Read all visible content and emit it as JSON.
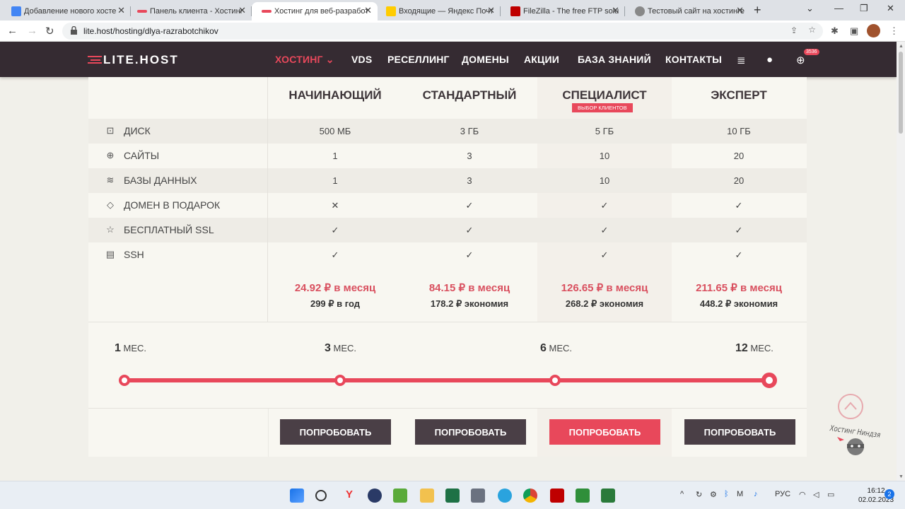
{
  "browser": {
    "tabs": [
      {
        "title": "Добавление нового хосте",
        "color": "#4285f4"
      },
      {
        "title": "Панель клиента - Хостинг",
        "color": "#e8485b"
      },
      {
        "title": "Хостинг для веб-разработ",
        "color": "#e8485b"
      },
      {
        "title": "Входящие — Яндекс Почт",
        "color": "#ffcc00"
      },
      {
        "title": "FileZilla - The free FTP solu",
        "color": "#bf0000"
      },
      {
        "title": "Тестовый сайт на хостинге",
        "color": "#666666"
      }
    ],
    "url": "lite.host/hosting/dlya-razrabotchikov"
  },
  "site": {
    "logo": "LITE.HOST",
    "menu": [
      "ХОСТИНГ",
      "VDS",
      "РЕСЕЛЛИНГ",
      "ДОМЕНЫ",
      "АКЦИИ",
      "БАЗА ЗНАНИЙ",
      "КОНТАКТЫ"
    ],
    "cart_badge": "3536"
  },
  "plans": [
    {
      "name": "НАЧИНАЮЩИЙ",
      "price": "24.92 ₽ в месяц",
      "save": "299 ₽ в год",
      "button": "ПОПРОБОВАТЬ"
    },
    {
      "name": "СТАНДАРТНЫЙ",
      "price": "84.15 ₽ в месяц",
      "save": "178.2 ₽ экономия",
      "button": "ПОПРОБОВАТЬ"
    },
    {
      "name": "СПЕЦИАЛИСТ",
      "badge": "ВЫБОР КЛИЕНТОВ",
      "price": "126.65 ₽ в месяц",
      "save": "268.2 ₽ экономия",
      "button": "ПОПРОБОВАТЬ"
    },
    {
      "name": "ЭКСПЕРТ",
      "price": "211.65 ₽ в месяц",
      "save": "448.2 ₽ экономия",
      "button": "ПОПРОБОВАТЬ"
    }
  ],
  "features": [
    {
      "label": "ДИСК",
      "icon": "disk-icon",
      "values": [
        "500 МБ",
        "3 ГБ",
        "5 ГБ",
        "10 ГБ"
      ]
    },
    {
      "label": "САЙТЫ",
      "icon": "globe-icon",
      "values": [
        "1",
        "3",
        "10",
        "20"
      ]
    },
    {
      "label": "БАЗЫ ДАННЫХ",
      "icon": "database-icon",
      "values": [
        "1",
        "3",
        "10",
        "20"
      ]
    },
    {
      "label": "ДОМЕН В ПОДАРОК",
      "icon": "tag-icon",
      "values": [
        "✕",
        "✓",
        "✓",
        "✓"
      ]
    },
    {
      "label": "БЕСПЛАТНЫЙ SSL",
      "icon": "star-icon",
      "values": [
        "✓",
        "✓",
        "✓",
        "✓"
      ]
    },
    {
      "label": "SSH",
      "icon": "terminal-icon",
      "values": [
        "✓",
        "✓",
        "✓",
        "✓"
      ]
    }
  ],
  "periods": [
    {
      "num": "1",
      "unit": "МЕС."
    },
    {
      "num": "3",
      "unit": "МЕС."
    },
    {
      "num": "6",
      "unit": "МЕС."
    },
    {
      "num": "12",
      "unit": "МЕС."
    }
  ],
  "selected_period": "12",
  "mascot_text": "Хостинг Ниндзя",
  "taskbar": {
    "lang": "РУС",
    "time": "16:12",
    "date": "02.02.2023",
    "notif": "2"
  }
}
